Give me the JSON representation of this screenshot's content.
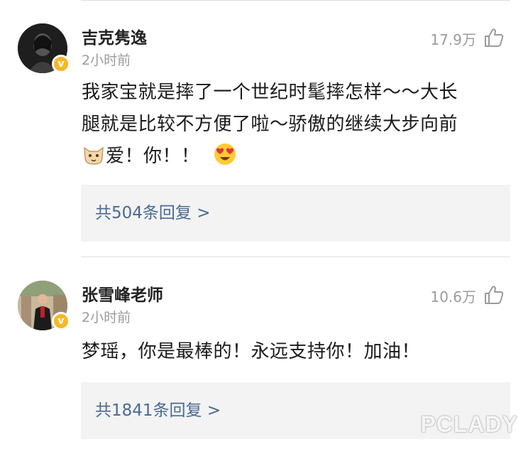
{
  "comments": [
    {
      "username": "吉克隽逸",
      "time": "2小时前",
      "likes": "17.9万",
      "text_line1": "我家宝就是摔了一个世纪时髦摔怎样～～大长",
      "text_line2": "腿就是比较不方便了啦～骄傲的继续大步向前",
      "text_line3": "爱！你！！",
      "replies": "共504条回复 >",
      "verified": "v"
    },
    {
      "username": "张雪峰老师",
      "time": "2小时前",
      "likes": "10.6万",
      "text_line1": "梦瑶，你是最棒的！永远支持你！加油！",
      "replies": "共1841条回复 >",
      "verified": "v"
    }
  ],
  "watermark": "PCLADY",
  "colors": {
    "reply_link": "#4a6a91",
    "reply_bg": "#f3f3f3",
    "muted": "#9b9b9b",
    "verified_badge": "#f6b825"
  },
  "icons": [
    "thumbs-up-icon",
    "verified-badge-icon",
    "cat-emoji-icon",
    "heart-eyes-emoji-icon"
  ]
}
